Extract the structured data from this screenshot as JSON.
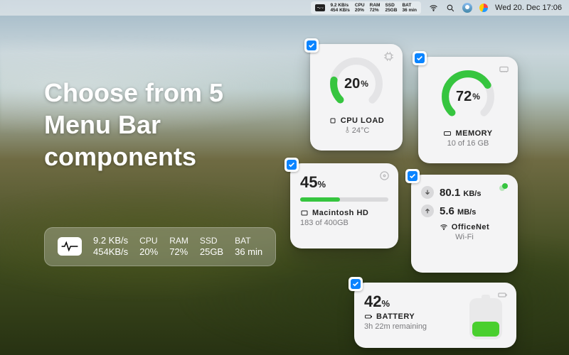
{
  "menubar": {
    "mini": {
      "net_down": "9.2 KB/s",
      "net_up": "454 KB/s",
      "cpu_label": "CPU",
      "cpu_val": "20%",
      "ram_label": "RAM",
      "ram_val": "72%",
      "ssd_label": "SSD",
      "ssd_val": "25GB",
      "bat_label": "BAT",
      "bat_val": "36 min"
    },
    "clock": "Wed 20. Dec 17:06"
  },
  "headline": "Choose from 5 Menu Bar components",
  "pill": {
    "net_down": "9.2 KB/s",
    "net_up": "454KB/s",
    "cpu_label": "CPU",
    "cpu_val": "20%",
    "ram_label": "RAM",
    "ram_val": "72%",
    "ssd_label": "SSD",
    "ssd_val": "25GB",
    "bat_label": "BAT",
    "bat_val": "36 min"
  },
  "cpu": {
    "percent": "20",
    "pct_sym": "%",
    "title": "CPU LOAD",
    "temp": "24°C"
  },
  "memory": {
    "percent": "72",
    "pct_sym": "%",
    "title": "MEMORY",
    "detail": "10 of 16 GB"
  },
  "disk": {
    "percent": "45",
    "pct_sym": "%",
    "title": "Macintosh HD",
    "detail": "183 of 400GB"
  },
  "net": {
    "down": "80.1",
    "down_unit": "KB/s",
    "up": "5.6",
    "up_unit": "MB/s",
    "ssid": "OfficeNet",
    "sub": "Wi-Fi"
  },
  "battery": {
    "percent": "42",
    "pct_sym": "%",
    "title": "BATTERY",
    "detail": "3h 22m remaining"
  }
}
